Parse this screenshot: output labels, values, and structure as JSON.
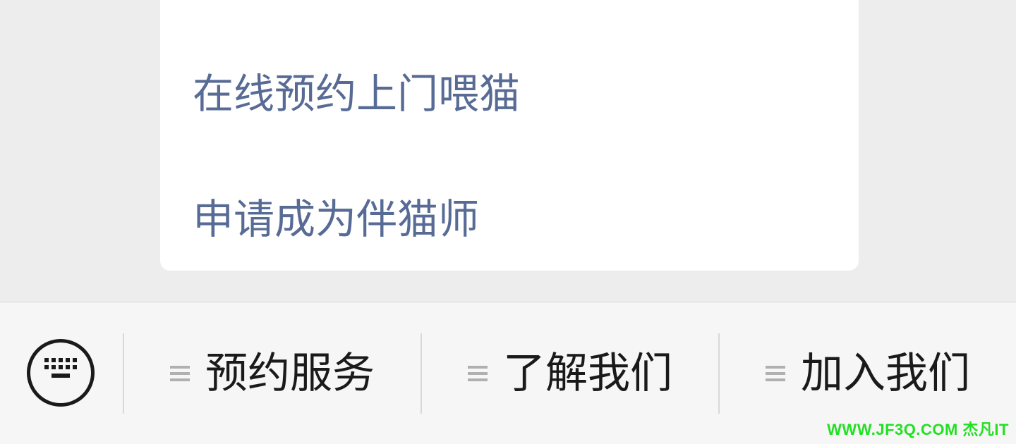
{
  "menu": {
    "items": [
      {
        "label": "在线预约上门喂猫"
      },
      {
        "label": "申请成为伴猫师"
      }
    ]
  },
  "bottom_bar": {
    "keyboard_icon": "keyboard-icon",
    "tabs": [
      {
        "label": "预约服务",
        "icon": "hamburger-icon"
      },
      {
        "label": "了解我们",
        "icon": "hamburger-icon"
      },
      {
        "label": "加入我们",
        "icon": "hamburger-icon"
      }
    ]
  },
  "watermark": {
    "text": "WWW.JF3Q.COM 杰凡IT"
  },
  "colors": {
    "page_background": "#ededed",
    "card_background": "#ffffff",
    "menu_link": "#576b95",
    "bar_background": "#f6f6f6",
    "tab_text": "#1a1a1a",
    "hamburger": "#b0b0b0",
    "watermark": "#22e022"
  }
}
